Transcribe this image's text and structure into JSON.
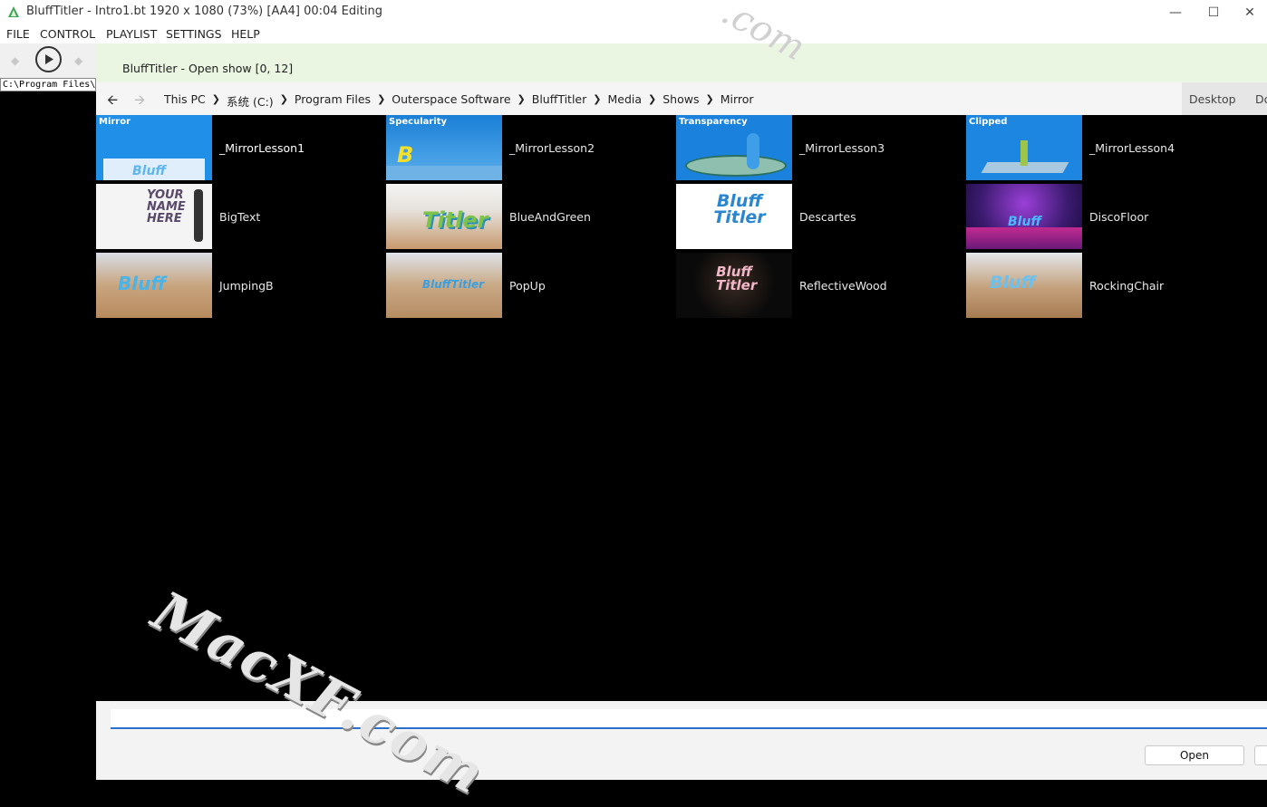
{
  "window": {
    "title": "BluffTitler - Intro1.bt 1920 x 1080 (73%) [AA4] 00:04 Editing",
    "minimize": "—",
    "maximize": "☐",
    "close": "✕"
  },
  "menu": [
    "FILE",
    "CONTROL",
    "PLAYLIST",
    "SETTINGS",
    "HELP"
  ],
  "path_text": "C:\\Program Files\\",
  "dialog": {
    "title": "BluffTitler - Open show [0, 12]",
    "breadcrumbs": [
      "This PC",
      "系统 (C:)",
      "Program Files",
      "Outerspace Software",
      "BluffTitler",
      "Media",
      "Shows",
      "Mirror"
    ],
    "quick_access": [
      "Desktop",
      "Down"
    ],
    "filename_value": "",
    "open_label": "Open"
  },
  "files": [
    {
      "name": "_MirrorLesson1",
      "caption": "Mirror",
      "thumb_word": "Bluff",
      "bg": "#1f8fe8",
      "selected": true
    },
    {
      "name": "_MirrorLesson2",
      "caption": "Specularity",
      "thumb_word": "B",
      "bg": "#1a7fd6"
    },
    {
      "name": "_MirrorLesson3",
      "caption": "Transparency",
      "thumb_word": "",
      "bg": "#1a82dd"
    },
    {
      "name": "_MirrorLesson4",
      "caption": "Clipped",
      "thumb_word": "",
      "bg": "#1c86e0"
    },
    {
      "name": "BigText",
      "caption": "",
      "thumb_word": "YOUR NAME HERE",
      "bg": "#ffffff"
    },
    {
      "name": "BlueAndGreen",
      "caption": "",
      "thumb_word": "Titler",
      "bg": "#c9a07a"
    },
    {
      "name": "Descartes",
      "caption": "",
      "thumb_word": "Bluff Titler",
      "bg": "#ffffff"
    },
    {
      "name": "DiscoFloor",
      "caption": "",
      "thumb_word": "Bluff",
      "bg": "#3a1a6e"
    },
    {
      "name": "JumpingB",
      "caption": "",
      "thumb_word": "Bluff",
      "bg": "#c8a57f"
    },
    {
      "name": "PopUp",
      "caption": "",
      "thumb_word": "BluffTitler",
      "bg": "#c9a985"
    },
    {
      "name": "ReflectiveWood",
      "caption": "",
      "thumb_word": "Bluff Titler",
      "bg": "#0a0a0a"
    },
    {
      "name": "RockingChair",
      "caption": "",
      "thumb_word": "Bluff",
      "bg": "#c3a07a"
    }
  ],
  "watermark": "MacXF.com",
  "watermark_top": ".com"
}
